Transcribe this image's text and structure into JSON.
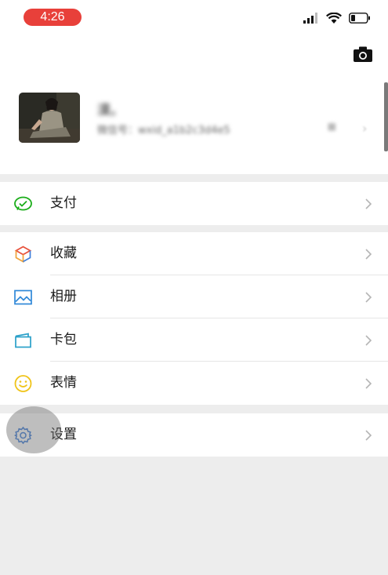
{
  "status_bar": {
    "time": "4:26"
  },
  "profile": {
    "name": "漠。",
    "wechat_id": "微信号：wxid_a1b2c3d4e5",
    "qr_label": "⊞"
  },
  "menu": {
    "pay": {
      "label": "支付",
      "icon": "wechat-pay-icon"
    },
    "favorites": {
      "label": "收藏",
      "icon": "cube-icon"
    },
    "album": {
      "label": "相册",
      "icon": "picture-icon"
    },
    "cards": {
      "label": "卡包",
      "icon": "card-wallet-icon"
    },
    "stickers": {
      "label": "表情",
      "icon": "smiley-icon"
    },
    "settings": {
      "label": "设置",
      "icon": "gear-icon"
    }
  },
  "colors": {
    "pay": "#1aad19",
    "favorites": "#f0a33a",
    "album": "#2f88d8",
    "cards": "#2aa0c9",
    "stickers": "#f0c419",
    "settings": "#3f7fdb",
    "status_time_bg": "#e8403a"
  }
}
